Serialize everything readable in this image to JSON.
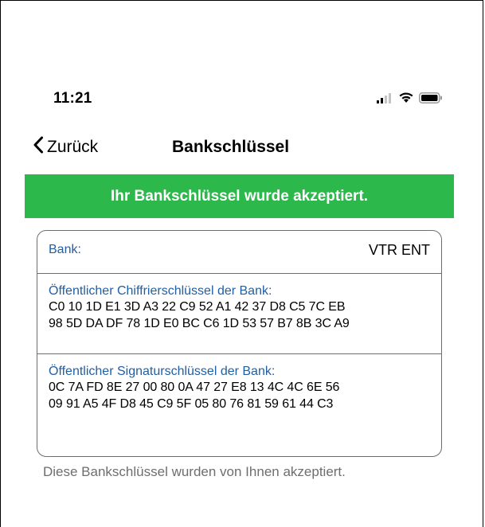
{
  "status_bar": {
    "time": "11:21",
    "icons": [
      "cellular-signal-icon",
      "wifi-icon",
      "battery-icon"
    ]
  },
  "nav": {
    "back_label": "Zurück",
    "title": "Bankschlüssel"
  },
  "banner": {
    "text": "Ihr Bankschlüssel wurde akzeptiert.",
    "color": "#2db84b"
  },
  "card": {
    "bank": {
      "label": "Bank:",
      "value": "VTR ENT"
    },
    "encryption_key": {
      "label": "Öffentlicher Chiffrierschlüssel der Bank:",
      "lines": [
        "C0 10 1D E1 3D A3 22 C9 52 A1 42 37 D8 C5 7C EB",
        "98 5D DA DF 78 1D E0 BC C6 1D 53 57 B7 8B 3C A9"
      ]
    },
    "signature_key": {
      "label": "Öffentlicher Signaturschlüssel der Bank:",
      "lines": [
        "0C 7A FD 8E 27 00 80 0A 47 27 E8 13 4C 4C 6E 56",
        "09 91 A5 4F D8 45 C9 5F 05 80 76 81 59 61 44 C3"
      ]
    }
  },
  "footer": {
    "note": "Diese Bankschlüssel wurden von Ihnen akzeptiert."
  },
  "colors": {
    "accent_blue": "#1f5fa6",
    "success_green": "#2db84b",
    "note_gray": "#6e6e6e"
  }
}
